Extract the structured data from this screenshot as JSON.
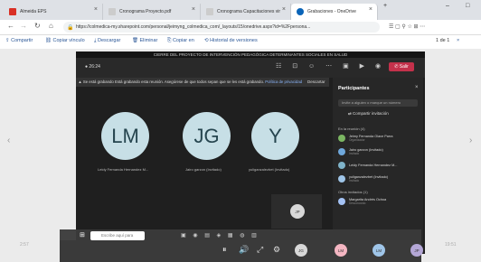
{
  "tabs": [
    {
      "label": "Almeida EPS",
      "color": "#d93025",
      "active": false
    },
    {
      "label": "Cronograma Proyecto.pdf",
      "color": "#666666",
      "active": false
    },
    {
      "label": "Cronograma Capacitaciones vir",
      "color": "#666666",
      "active": false
    },
    {
      "label": "Grabaciones - OneDrive",
      "color": "#0a64b8",
      "active": true
    }
  ],
  "address": {
    "url": "https://colmedica-my.sharepoint.com/personal/jeimyng_colmedica_com/_layouts/15/onedrive.aspx?id=%2Fpersona..."
  },
  "commands": [
    "Compartir",
    "Copiar vínculo",
    "Descargar",
    "Eliminar",
    "Copiar en",
    "Historial de versiones"
  ],
  "pager": "1 de 1",
  "meeting": {
    "title": "CIERRE DEL PROYECTO DE INTERVENCIÓN PEDAGÓGICA DETERMINANTES SOCIALES EN SALUD",
    "timer": "26:24",
    "leave_label": "Salir",
    "recording_banner": "Se está grabando  Está grabando esta reunión. Asegúrese de que todos sepan que se les está grabando.",
    "privacy_link": "Política de privacidad",
    "dismiss_label": "Descartar",
    "participants": [
      {
        "initials": "LM",
        "name": "Leidy Fernanda Hernandez M..."
      },
      {
        "initials": "JG",
        "name": "Jairo garzon (Invitado)"
      },
      {
        "initials": "Y",
        "name": "yuliganzalezbet (Invitado)"
      }
    ],
    "self_initials": "JP"
  },
  "panel": {
    "title": "Participantes",
    "search_placeholder": "Invite a alguien o marque un número",
    "share_label": "Compartir invitación",
    "section_meeting": "En la reunión (4)",
    "people": [
      {
        "name": "Jeimy Fernanda Olave Parra",
        "role": "Organizador"
      },
      {
        "name": "Jairo garzon (Invitado)",
        "role": "Invitado"
      },
      {
        "name": "Leidy Fernanda Hernandez M...",
        "role": ""
      },
      {
        "name": "yuliganzalezbet (Invitado)",
        "role": "Invitado"
      }
    ],
    "section_others": "Otros invitados (1)",
    "others": [
      {
        "name": "Margarita Andrés Ochoa",
        "role": "Desconocido"
      }
    ]
  },
  "taskbar": {
    "search_placeholder": "Escribe aquí para buscar"
  },
  "player": {
    "current_time": "2:57",
    "total_time": "19:51",
    "bottom_avatars": [
      "JG",
      "LM",
      "JP"
    ]
  },
  "colors": {
    "accent": "#0a64b8",
    "leave": "#c4314b"
  }
}
